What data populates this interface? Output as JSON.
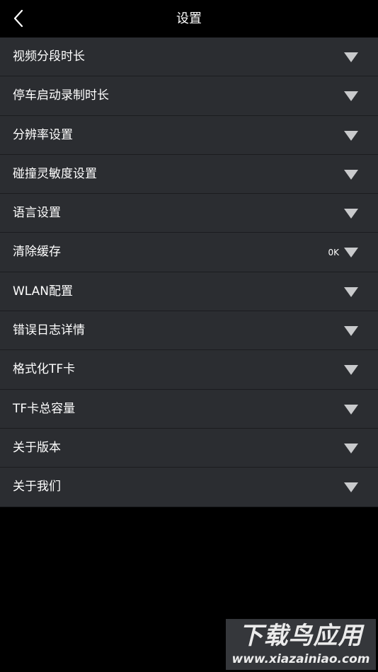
{
  "header": {
    "title": "设置",
    "back_icon": "chevron-left-icon"
  },
  "settings": {
    "items": [
      {
        "label": "视频分段时长",
        "value": ""
      },
      {
        "label": "停车启动录制时长",
        "value": ""
      },
      {
        "label": "分辨率设置",
        "value": ""
      },
      {
        "label": "碰撞灵敏度设置",
        "value": ""
      },
      {
        "label": "语言设置",
        "value": ""
      },
      {
        "label": "清除缓存",
        "value": "0K"
      },
      {
        "label": "WLAN配置",
        "value": ""
      },
      {
        "label": "错误日志详情",
        "value": ""
      },
      {
        "label": "格式化TF卡",
        "value": ""
      },
      {
        "label": "TF卡总容量",
        "value": ""
      },
      {
        "label": "关于版本",
        "value": ""
      },
      {
        "label": "关于我们",
        "value": ""
      }
    ],
    "row_icon": "triangle-down-icon"
  },
  "watermark": {
    "title": "下载鸟应用",
    "url": "www.xiazainiao.com"
  },
  "colors": {
    "background": "#000000",
    "row_background": "#2b2d31",
    "row_divider": "#1b1c1f",
    "text": "#ffffff",
    "chevron": "#c9cacc"
  }
}
